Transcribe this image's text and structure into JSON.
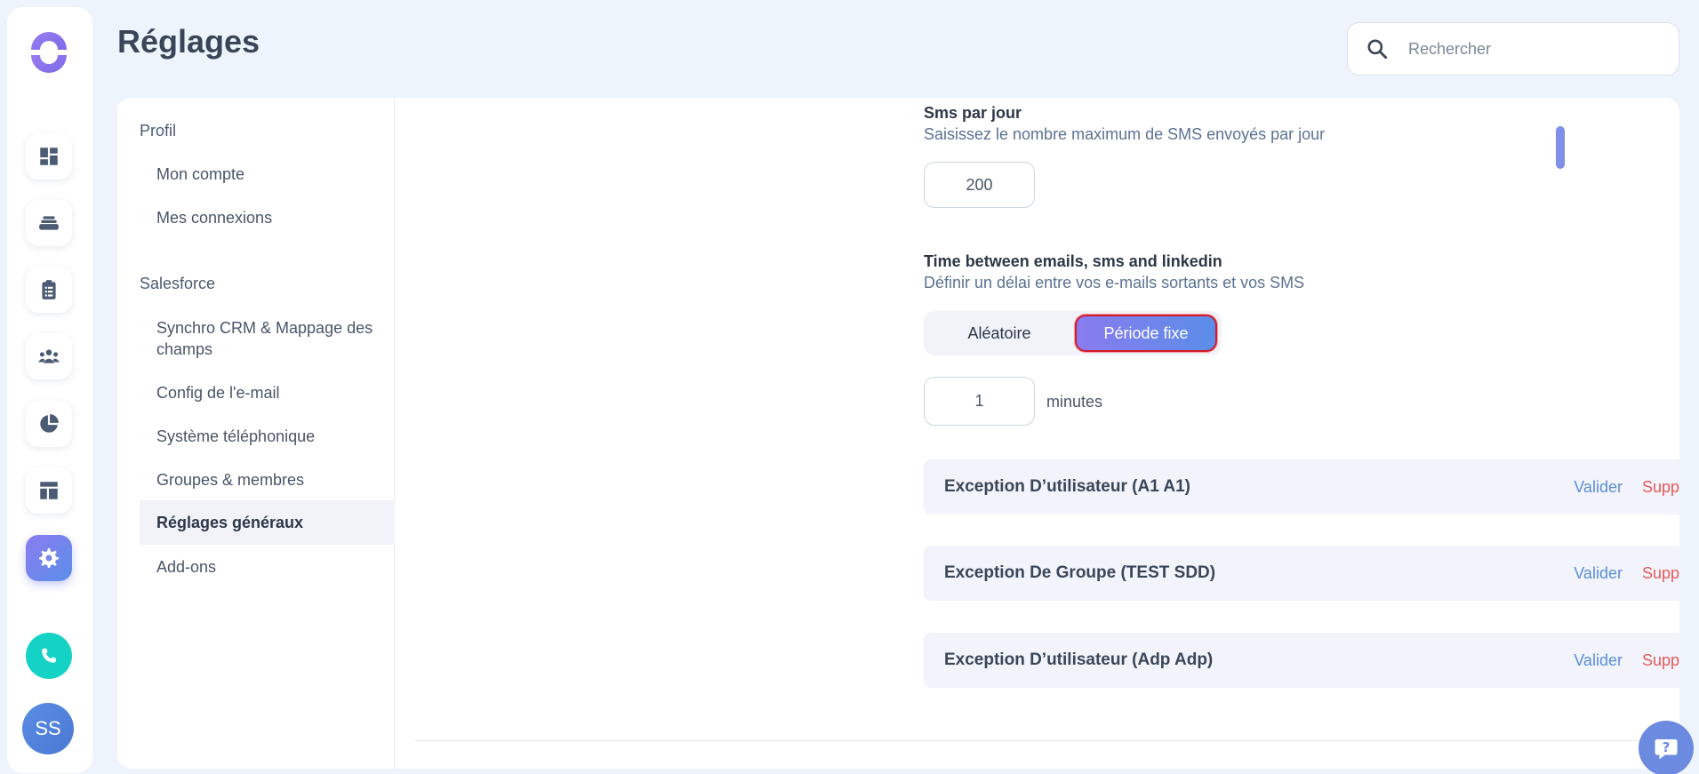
{
  "header": {
    "title": "Réglages",
    "search_placeholder": "Rechercher"
  },
  "rail": {
    "items": [
      {
        "icon": "dashboard-icon"
      },
      {
        "icon": "layers-icon"
      },
      {
        "icon": "clipboard-icon"
      },
      {
        "icon": "users-icon"
      },
      {
        "icon": "pie-chart-icon"
      },
      {
        "icon": "layout-icon"
      },
      {
        "icon": "gear-icon",
        "active": true
      }
    ],
    "phone_icon": "phone-icon",
    "avatar_initials": "SS"
  },
  "subnav": {
    "sections": [
      {
        "title": "Profil",
        "items": [
          "Mon compte",
          "Mes connexions"
        ]
      },
      {
        "title": "Salesforce",
        "items": [
          "Synchro CRM & Mappage des champs",
          "Config de l'e-mail",
          "Système téléphonique",
          "Groupes & membres",
          "Réglages généraux",
          "Add-ons"
        ]
      }
    ],
    "active_item": "Réglages généraux"
  },
  "settings": {
    "sms": {
      "title": "Sms par jour",
      "description": "Saisissez le nombre maximum de SMS envoyés par jour",
      "value": "200"
    },
    "delay": {
      "title": "Time between emails, sms and linkedin",
      "description": "Définir un délai entre vos e-mails sortants et vos SMS",
      "options": [
        "Aléatoire",
        "Période fixe"
      ],
      "selected": "Période fixe",
      "value": "1",
      "unit": "minutes"
    },
    "exceptions": [
      {
        "title": "Exception D’utilisateur (A1 A1)",
        "validate": "Valider",
        "delete": "Supprimer"
      },
      {
        "title": "Exception De Groupe (TEST SDD)",
        "validate": "Valider",
        "delete": "Supprimer"
      },
      {
        "title": "Exception D’utilisateur (Adp Adp)",
        "validate": "Valider",
        "delete": "Supprimer"
      }
    ]
  },
  "colors": {
    "accent": "#8a7bee",
    "accent2": "#5a8ee8",
    "danger": "#e55a5a",
    "link": "#5b8fd6",
    "phone": "#14d3c4"
  }
}
